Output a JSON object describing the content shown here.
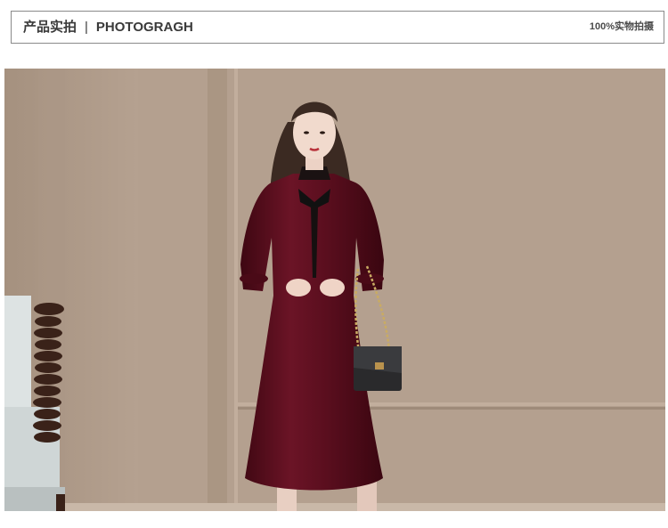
{
  "header": {
    "title_cn": "产品实拍",
    "separator": "|",
    "title_en": "PHOTOGRAGH",
    "right_note": "100%实物拍摄"
  },
  "photo": {
    "subject": "model-wearing-velvet-dress",
    "colors": {
      "wall": "#b3a08f",
      "dress": "#5a0e1e",
      "bow": "#111111"
    }
  }
}
